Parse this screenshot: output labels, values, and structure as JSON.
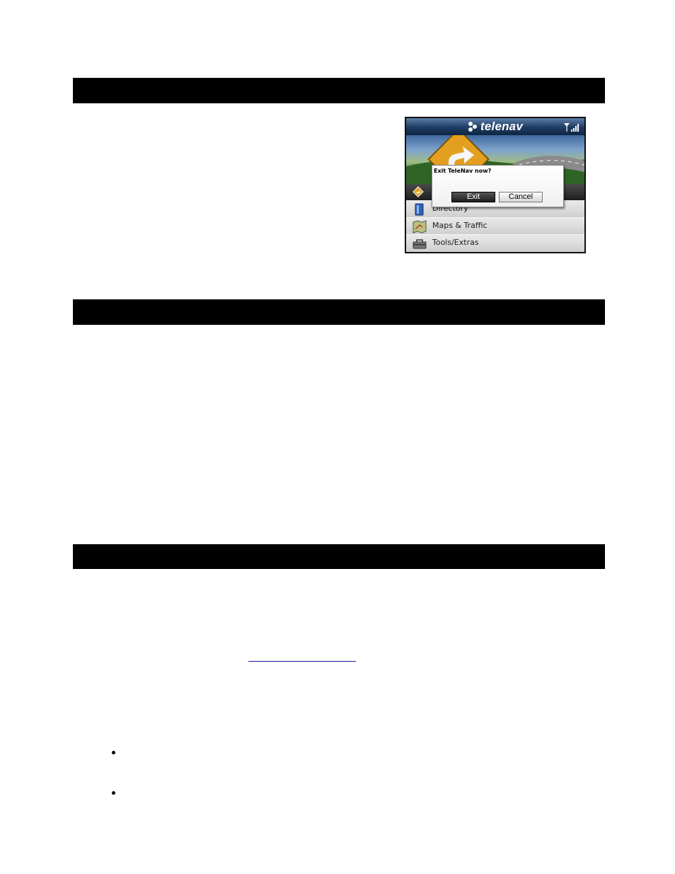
{
  "screenshot": {
    "header": {
      "logo_text": "telenav",
      "logo_icon": "telenav-logo-icon",
      "signal_icon": "signal-strength-icon"
    },
    "dialog": {
      "message": "Exit TeleNav now?",
      "exit_label": "Exit",
      "cancel_label": "Cancel"
    },
    "menu": [
      {
        "label": "Directory",
        "icon": "directory-book-icon"
      },
      {
        "label": "Maps & Traffic",
        "icon": "map-icon"
      },
      {
        "label": "Tools/Extras",
        "icon": "toolbox-icon"
      }
    ]
  },
  "colors": {
    "header_blue": "#1d3c63",
    "section_bar": "#000000",
    "link_blue": "#1a1aa0"
  }
}
